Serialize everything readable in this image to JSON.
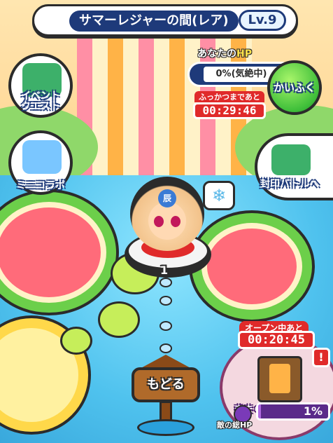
{
  "header": {
    "title": "サマーレジャーの間(レア)",
    "level": "Lv.9"
  },
  "side_menu": {
    "event_quest": "イベント\nクエスト",
    "mini_collab": "ミニコラボ"
  },
  "hp_panel": {
    "title_prefix": "あなたの",
    "title_hp": "HP",
    "value": "0%(気絶中)",
    "revive_label": "ふっかつまであと",
    "revive_timer": "00:29:46",
    "heal_button": "かいふく"
  },
  "seal_battle": {
    "label": "封印バトルへ"
  },
  "map": {
    "node_number": "1",
    "emblem_text": "辰"
  },
  "back_button": {
    "label": "もどる"
  },
  "whim_gate": {
    "open_label": "オープン中あと",
    "open_timer": "00:20:45",
    "label": "きまぐれゲート",
    "alert": "!",
    "enemy_hp_label": "敵の総HP",
    "enemy_hp_value": "1%",
    "enemy_hp_fraction": 0.01
  },
  "colors": {
    "navy": "#1e3a7a",
    "alert_red": "#e02a2a",
    "heal_green": "#3fbf3a"
  }
}
